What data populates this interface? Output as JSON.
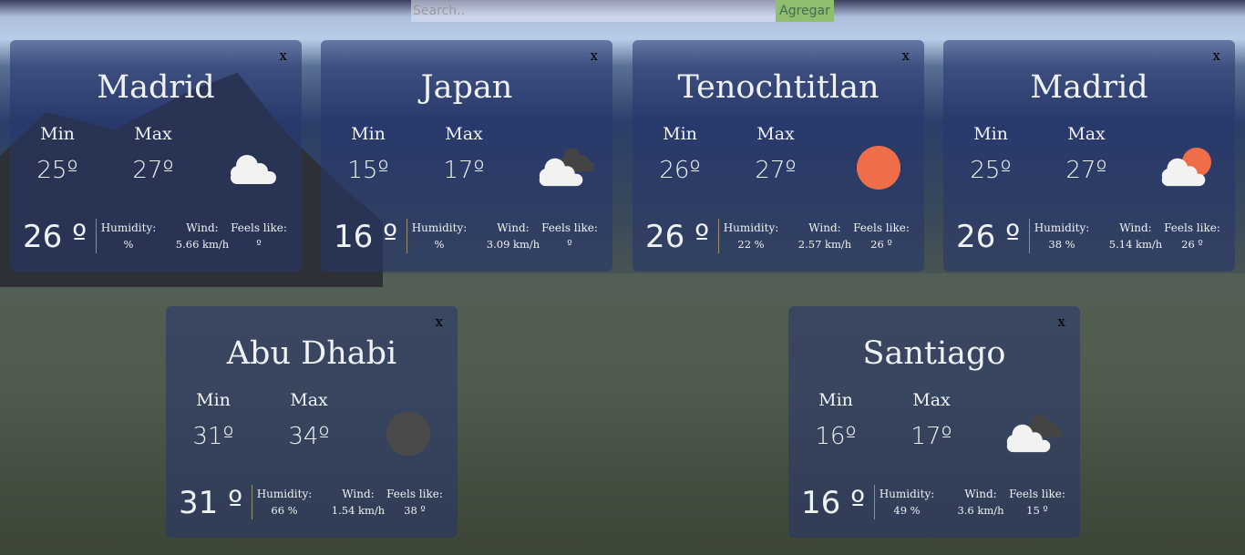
{
  "search": {
    "placeholder": "Search..",
    "button_label": "Agregar"
  },
  "labels": {
    "min": "Min",
    "max": "Max",
    "humidity": "Humidity:",
    "wind": "Wind:",
    "feels": "Feels like:",
    "close": "x"
  },
  "cards": [
    {
      "city": "Madrid",
      "min": "25º",
      "max": "27º",
      "temp": "26 º",
      "humidity": "%",
      "wind": "5.66 km/h",
      "feels": "º",
      "icon": "cloud-icon"
    },
    {
      "city": "Japan",
      "min": "15º",
      "max": "17º",
      "temp": "16 º",
      "humidity": "%",
      "wind": "3.09 km/h",
      "feels": "º",
      "icon": "clouds-icon"
    },
    {
      "city": "Tenochtitlan",
      "min": "26º",
      "max": "27º",
      "temp": "26 º",
      "humidity": "22 %",
      "wind": "2.57 km/h",
      "feels": "26 º",
      "icon": "sun-icon"
    },
    {
      "city": "Madrid",
      "min": "25º",
      "max": "27º",
      "temp": "26 º",
      "humidity": "38 %",
      "wind": "5.14 km/h",
      "feels": "26 º",
      "icon": "sun-cloud-icon"
    },
    {
      "city": "Abu Dhabi",
      "min": "31º",
      "max": "34º",
      "temp": "31 º",
      "humidity": "66 %",
      "wind": "1.54 km/h",
      "feels": "38 º",
      "icon": "moon-icon"
    },
    {
      "city": "Santiago",
      "min": "16º",
      "max": "17º",
      "temp": "16 º",
      "humidity": "49 %",
      "wind": "3.6 km/h",
      "feels": "15 º",
      "icon": "clouds-icon"
    }
  ],
  "colors": {
    "sun": "#ee6e4a",
    "cloud": "#f2f2f0",
    "dark_cloud": "#444444",
    "moon": "#4a4a4a",
    "button": "#8fbf6e"
  }
}
